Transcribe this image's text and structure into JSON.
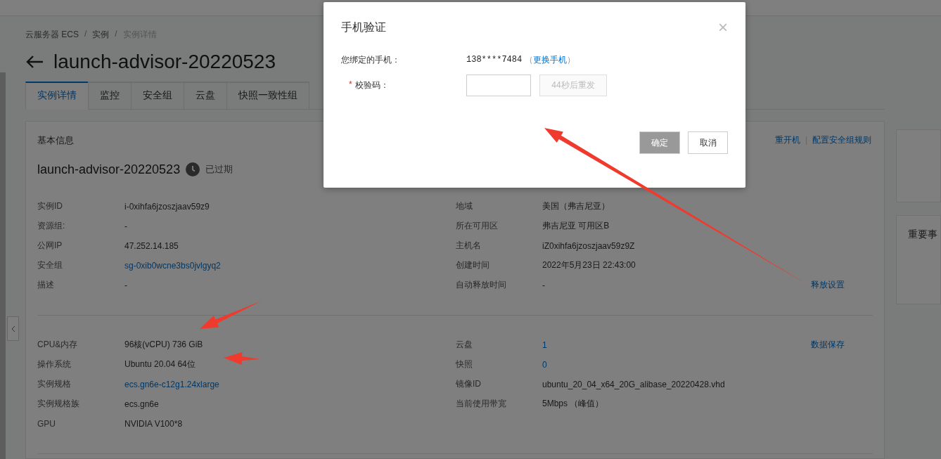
{
  "breadcrumb_separator": "/",
  "breadcrumb": [
    {
      "label": "云服务器 ECS",
      "current": false
    },
    {
      "label": "实例",
      "current": false
    },
    {
      "label": "实例详情",
      "current": true
    }
  ],
  "page_title": "launch-advisor-20220523",
  "tabs": [
    {
      "label": "实例详情",
      "selected": true
    },
    {
      "label": "监控",
      "selected": false
    },
    {
      "label": "安全组",
      "selected": false
    },
    {
      "label": "云盘",
      "selected": false
    },
    {
      "label": "快照一致性组",
      "selected": false
    }
  ],
  "card": {
    "title": "基本信息",
    "actions": [
      "重开机",
      "配置安全组规则"
    ],
    "instance_name": "launch-advisor-20220523",
    "status": "已过期",
    "sections": [
      {
        "left": [
          {
            "label": "实例ID",
            "value": "i-0xihfa6jzoszjaav59z9",
            "link": false
          },
          {
            "label": "资源组:",
            "value": "-",
            "link": false
          },
          {
            "label": "公网IP",
            "value": "47.252.14.185",
            "link": false
          },
          {
            "label": "安全组",
            "value": "sg-0xib0wcne3bs0jvlgyq2",
            "link": true
          },
          {
            "label": "描述",
            "value": "-",
            "link": false
          }
        ],
        "right": [
          {
            "label": "地域",
            "value": "美国（弗吉尼亚）",
            "link": false
          },
          {
            "label": "所在可用区",
            "value": "弗吉尼亚 可用区B",
            "link": false
          },
          {
            "label": "主机名",
            "value": "iZ0xihfa6jzoszjaav59z9Z",
            "link": false
          },
          {
            "label": "创建时间",
            "value": "2022年5月23日 22:43:00",
            "link": false
          },
          {
            "label": "自动释放时间",
            "value": "-",
            "link": false,
            "action": "释放设置"
          }
        ]
      },
      {
        "left": [
          {
            "label": "CPU&内存",
            "value": "96核(vCPU) 736 GiB",
            "link": false
          },
          {
            "label": "操作系统",
            "value": "Ubuntu 20.04 64位",
            "link": false
          },
          {
            "label": "实例规格",
            "value": "ecs.gn6e-c12g1.24xlarge",
            "link": true
          },
          {
            "label": "实例规格族",
            "value": "ecs.gn6e",
            "link": false
          },
          {
            "label": "GPU",
            "value": "NVIDIA V100*8",
            "link": false
          }
        ],
        "right": [
          {
            "label": "云盘",
            "value": "1",
            "link": true,
            "action": "数据保存"
          },
          {
            "label": "快照",
            "value": "0",
            "link": true
          },
          {
            "label": "镜像ID",
            "value": "ubuntu_20_04_x64_20G_alibase_20220428.vhd",
            "link": false
          },
          {
            "label": "当前使用带宽",
            "value": "5Mbps （峰值）",
            "link": false
          }
        ]
      }
    ]
  },
  "side_panel_title": "重要事",
  "modal": {
    "title": "手机验证",
    "close": "×",
    "phone_label": "您绑定的手机：",
    "phone": "138****7484",
    "change_link": {
      "before": "（",
      "label": "更换手机",
      "after": "）"
    },
    "code_label": "校验码：",
    "required_mark": "*",
    "resend": {
      "label": "44秒后重发",
      "disabled": true
    },
    "confirm": {
      "label": "确定",
      "disabled": true
    },
    "cancel": {
      "label": "取消",
      "disabled": false
    }
  }
}
